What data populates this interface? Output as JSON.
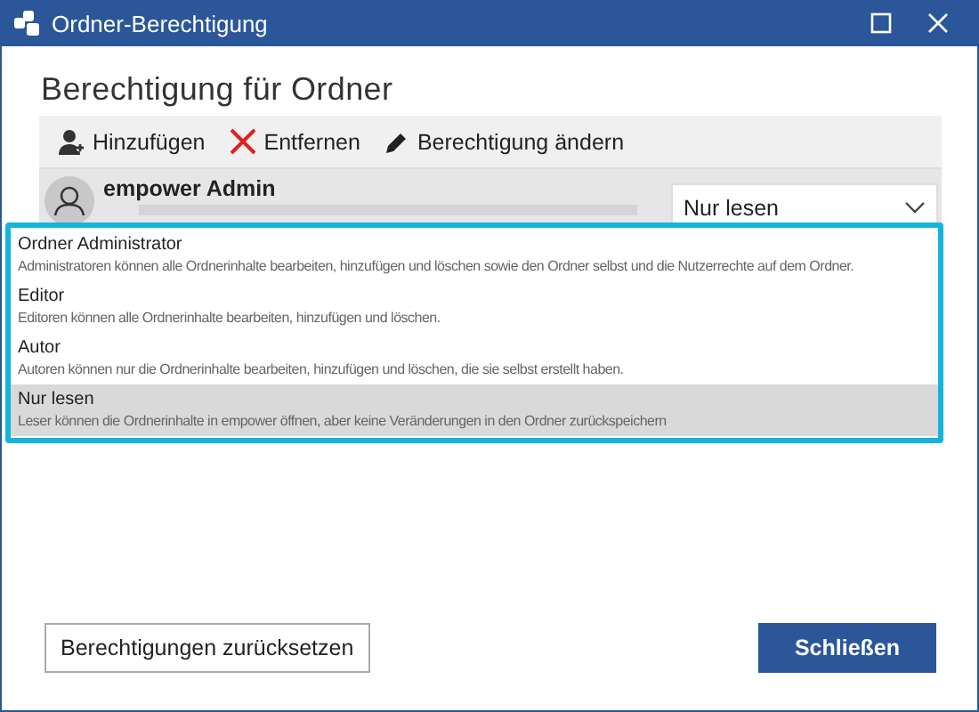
{
  "window": {
    "title": "Ordner-Berechtigung"
  },
  "heading": "Berechtigung für Ordner",
  "toolbar": [
    {
      "kind": "add",
      "label": "Hinzufügen"
    },
    {
      "kind": "remove",
      "label": "Entfernen"
    },
    {
      "kind": "edit",
      "label": "Berechtigung ändern"
    }
  ],
  "user": {
    "name": "empower Admin",
    "role": "Nur lesen"
  },
  "roles": [
    {
      "name": "Ordner Administrator",
      "description": "Administratoren können alle Ordnerinhalte bearbeiten, hinzufügen und  löschen sowie den Ordner selbst und die Nutzerrechte auf dem Ordner.",
      "selected": false
    },
    {
      "name": "Editor",
      "description": "Editoren können alle Ordnerinhalte bearbeiten, hinzufügen und löschen.",
      "selected": false
    },
    {
      "name": "Autor",
      "description": "Autoren können nur die Ordnerinhalte bearbeiten, hinzufügen und löschen, die sie selbst erstellt haben.",
      "selected": false
    },
    {
      "name": "Nur lesen",
      "description": "Leser können die Ordnerinhalte in empower öffnen, aber keine Veränderungen in den Ordner zurückspeichern",
      "selected": true
    }
  ],
  "buttons": [
    {
      "kind": "secondary",
      "label": "Berechtigungen zurücksetzen"
    },
    {
      "kind": "primary",
      "label": "Schließen"
    }
  ]
}
